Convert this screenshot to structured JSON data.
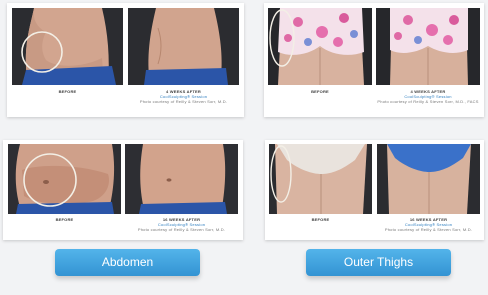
{
  "cards": [
    {
      "before": {
        "label": "BEFORE"
      },
      "after": {
        "label": "4 WEEKS AFTER",
        "sub": "CoolSculpting® Session",
        "credit": "Photo courtesy of Reilly & Steven Sorr, M.D."
      }
    },
    {
      "before": {
        "label": "BEFORE"
      },
      "after": {
        "label": "4 WEEKS AFTER",
        "sub": "CoolSculpting® Session",
        "credit": "Photo courtesy of Reilly & Steven Sorr, M.D., FACS"
      }
    },
    {
      "before": {
        "label": "BEFORE"
      },
      "after": {
        "label": "16 WEEKS AFTER",
        "sub": "CoolSculpting® Session",
        "credit": "Photo courtesy of Reilly & Steven Sorr, M.D."
      }
    },
    {
      "before": {
        "label": "BEFORE"
      },
      "after": {
        "label": "16 WEEKS AFTER",
        "sub": "CoolSculpting® Session",
        "credit": "Photo courtesy of Reilly & Steven Sorr, M.D."
      }
    }
  ],
  "buttons": {
    "abdomen": "Abdomen",
    "outer_thighs": "Outer Thighs"
  },
  "colors": {
    "accent": "#3aa0de",
    "highlight_circle": "#f3efe6"
  }
}
